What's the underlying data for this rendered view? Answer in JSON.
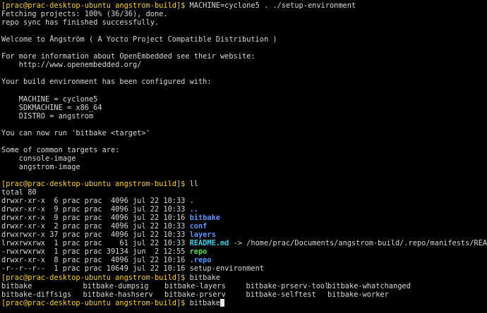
{
  "prompt": "[prac@prac-desktop-ubuntu angstrom-build]$",
  "cmd1": "MACHINE=cyclone5 . ./setup-environment",
  "out1": [
    "Fetching projects: 100% (36/36), done.",
    "repo sync has finished successfully.",
    "",
    "Welcome to Ångström ( A Yocto Project Compatible Distribution )",
    "",
    "For more information about OpenEmbedded see their website:",
    "    http://www.openembedded.org/",
    "",
    "Your build environment has been configured with:",
    "",
    "    MACHINE = cyclone5",
    "    SDKMACHINE = x86_64",
    "    DISTRO = angstrom",
    "",
    "You can now run 'bitbake <target>'",
    "",
    "Some of common targets are:",
    "    console-image",
    "    angstrom-image",
    ""
  ],
  "cmd2": "ll",
  "total": "total 80",
  "listing": [
    {
      "meta": "drwxr-xr-x  6 prac prac  4096 jul 22 10:33 ",
      "name": "."
    },
    {
      "meta": "drwxr-xr-x  9 prac prac  4096 jul 22 10:33 ",
      "name": ".."
    },
    {
      "meta": "drwxr-xr-x  9 prac prac  4096 jul 22 10:16 ",
      "name": "bitbake"
    },
    {
      "meta": "drwxr-xr-x  2 prac prac  4096 jul 22 10:33 ",
      "name": "conf"
    },
    {
      "meta": "drwxrwxr-x 37 prac prac  4096 jul 22 10:33 ",
      "name": "layers"
    },
    {
      "meta": "lrwxrwxrwx  1 prac prac    61 jul 22 10:33 ",
      "name": "README.md",
      "target": " -> /home/prac/Documents/angstrom-build/.repo/manifests/README.md"
    },
    {
      "meta": "-rwxrwxrwx  1 prac prac 39134 jun  2 12:55 ",
      "name": "repo"
    },
    {
      "meta": "drwxr-xr-x  8 prac prac  4096 jul 22 10:16 ",
      "name": ".repo"
    },
    {
      "meta": "-r--r--r--  1 prac prac 10649 jul 22 10:16 ",
      "name": "setup-environment"
    }
  ],
  "cmd3": "bitbake",
  "completions": [
    [
      "bitbake",
      "bitbake-dumpsig",
      "bitbake-layers",
      "bitbake-prserv-tool",
      "bitbake-whatchanged"
    ],
    [
      "bitbake-diffsigs",
      "bitbake-hashserv",
      "bitbake-prserv",
      "bitbake-selftest",
      "bitbake-worker"
    ]
  ],
  "cmd4": "bitbake",
  "colors": {
    "background": "#000000",
    "prompt": "#ffd200",
    "directory": "#5a95ff",
    "symlink": "#34d0e6",
    "executable": "#4fe04f"
  }
}
